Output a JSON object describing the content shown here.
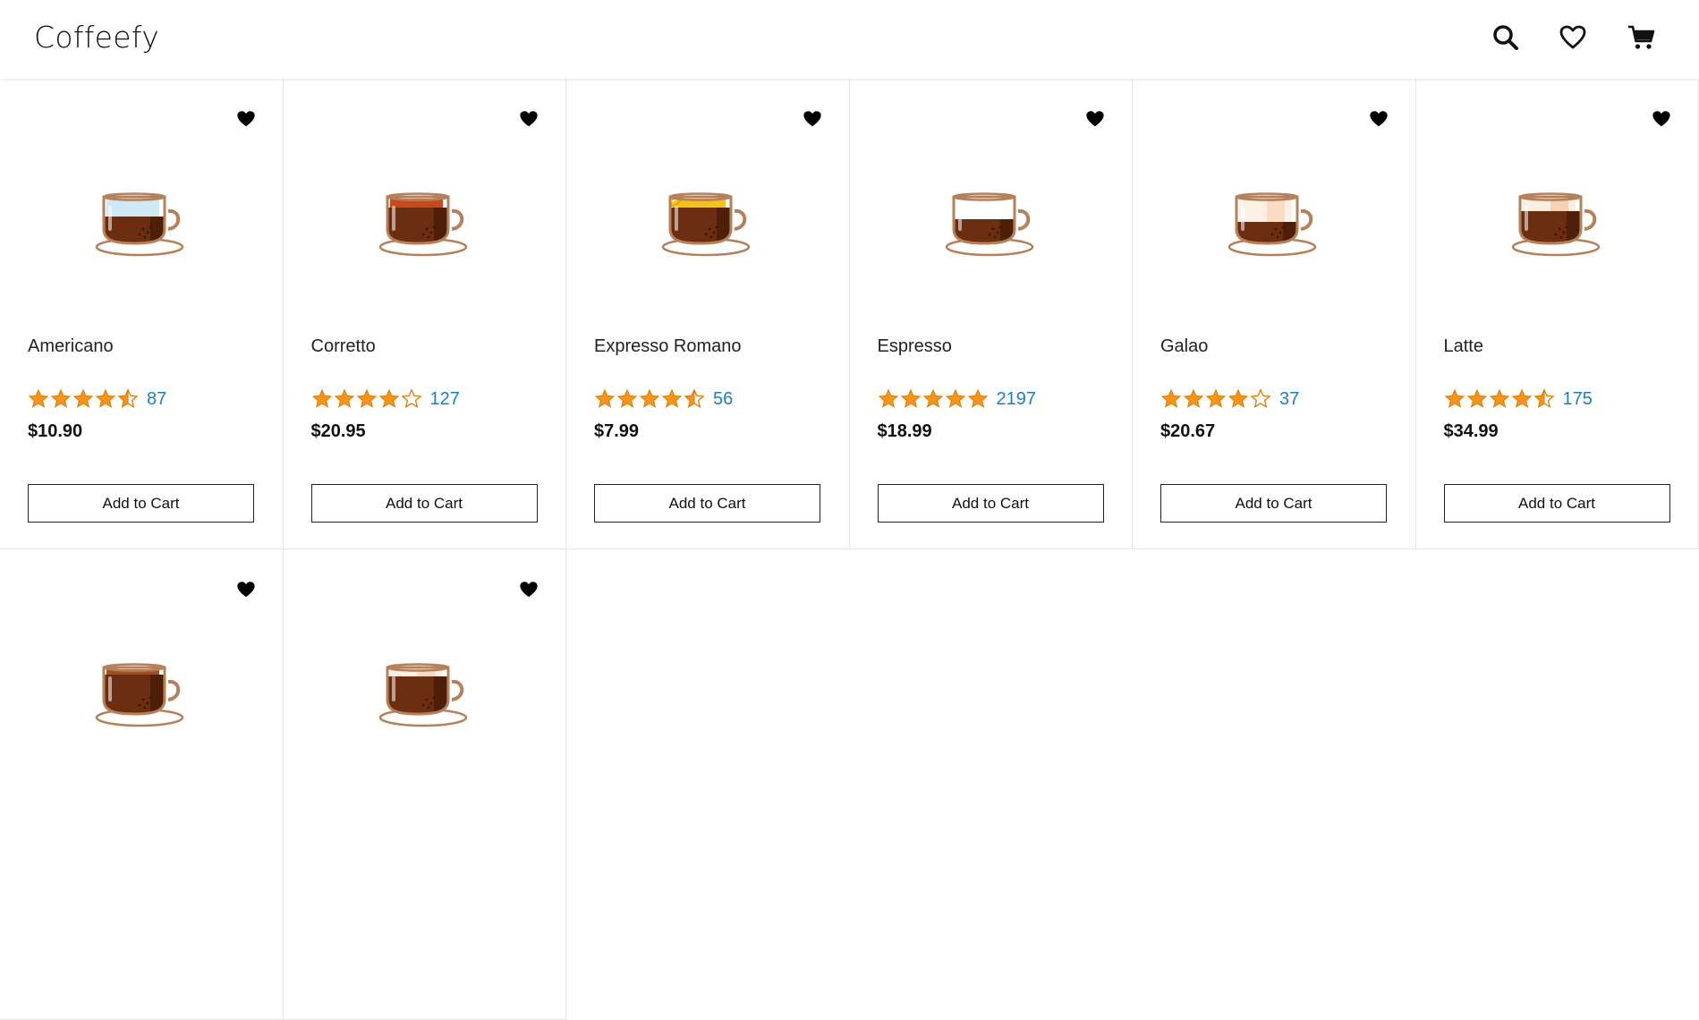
{
  "app": {
    "title": "Coffeefy"
  },
  "header": {
    "icons": [
      "search-icon",
      "heart-icon",
      "cart-icon"
    ]
  },
  "colors": {
    "star": "#f7941d",
    "star_outline": "#e07b00",
    "count_link": "#1a7fc1",
    "cup_outline": "#b5815a",
    "coffee": "#6b2e10"
  },
  "add_to_cart_label": "Add to Cart",
  "products": [
    {
      "name": "Americano",
      "rating": 4.5,
      "count": "87",
      "price": "$10.90",
      "top": "#cfe9f7"
    },
    {
      "name": "Corretto",
      "rating": 4,
      "count": "127",
      "price": "$20.95",
      "top": "#c84a1c"
    },
    {
      "name": "Expresso Romano",
      "rating": 4.5,
      "count": "56",
      "price": "$7.99",
      "top": "#f4c21b"
    },
    {
      "name": "Espresso",
      "rating": 5,
      "count": "2197",
      "price": "$18.99",
      "top": "none"
    },
    {
      "name": "Galao",
      "rating": 4,
      "count": "37",
      "price": "$20.67",
      "top": "#fbe9d8"
    },
    {
      "name": "Latte",
      "rating": 4.5,
      "count": "175",
      "price": "$34.99",
      "top": "#f6ddc4"
    },
    {
      "name": "",
      "rating": null,
      "count": "",
      "price": "",
      "top": "#6b2e10"
    },
    {
      "name": "",
      "rating": null,
      "count": "",
      "price": "",
      "top": "#fbe9d8"
    }
  ]
}
